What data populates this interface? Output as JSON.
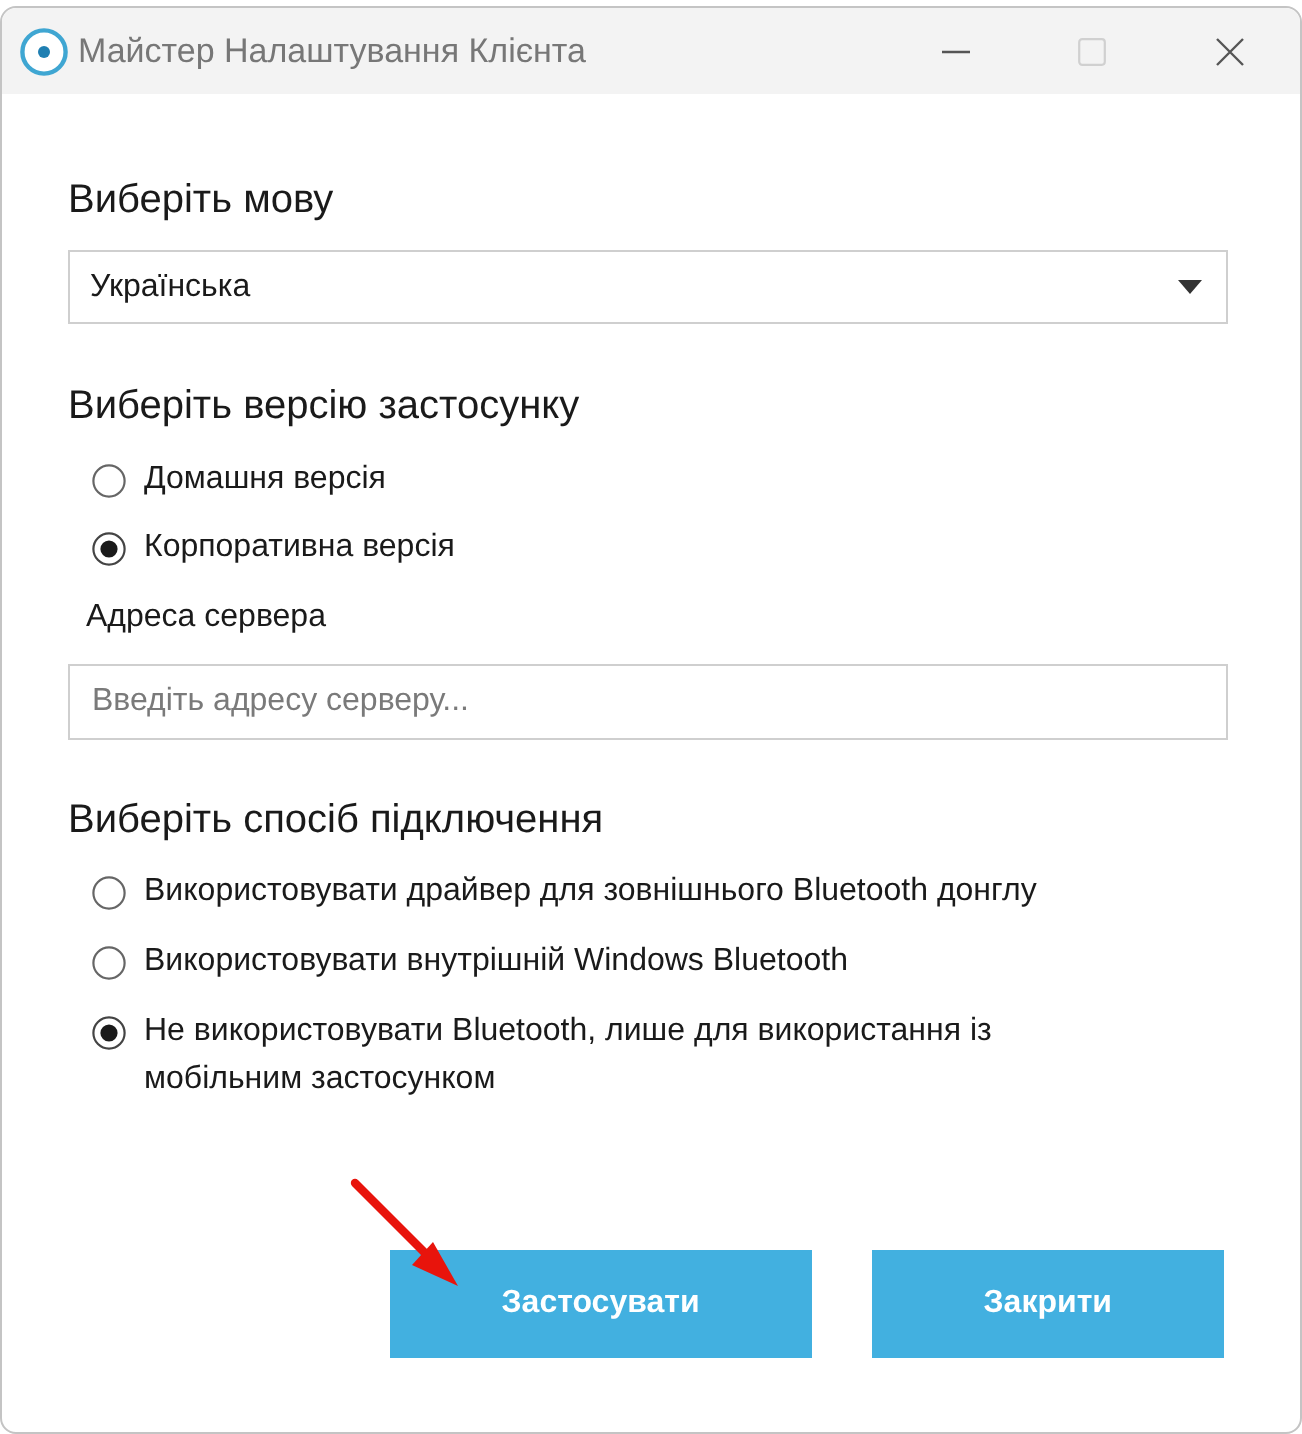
{
  "window": {
    "title": "Майстер Налаштування Клієнта",
    "maximize_disabled": true
  },
  "language": {
    "heading": "Виберіть мову",
    "value": "Українська"
  },
  "version": {
    "heading": "Виберіть версію застосунку",
    "options": [
      {
        "label": "Домашня версія",
        "selected": false
      },
      {
        "label": "Корпоративна версія",
        "selected": true
      }
    ],
    "server_address": {
      "label": "Адреса сервера",
      "placeholder": "Введіть адресу серверу..."
    }
  },
  "connection": {
    "heading": "Виберіть спосіб підключення",
    "options": [
      {
        "label": "Використовувати драйвер для зовнішнього Bluetooth донглу",
        "selected": false
      },
      {
        "label": "Використовувати внутрішній Windows Bluetooth",
        "selected": false
      },
      {
        "label": "Не використовувати Bluetooth, лише для використання із мобільним застосунком",
        "selected": true
      }
    ]
  },
  "buttons": [
    {
      "label": "Застосувати",
      "pointed_at": true
    },
    {
      "label": "Закрити",
      "pointed_at": false
    }
  ]
}
